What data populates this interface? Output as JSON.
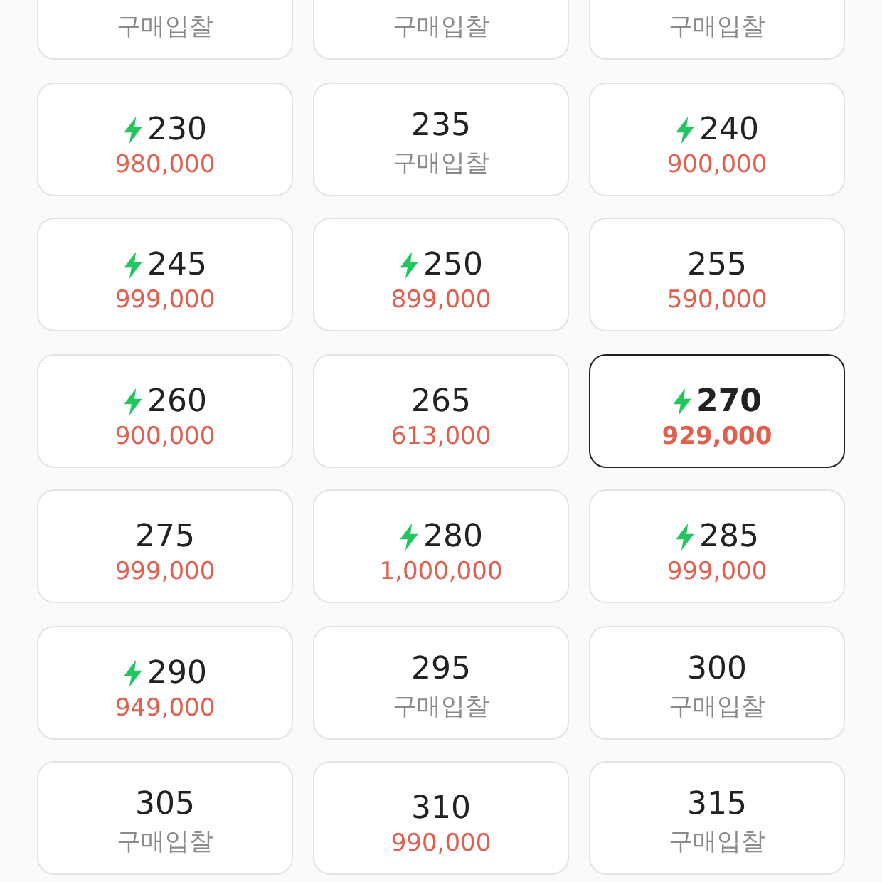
{
  "sizes": [
    {
      "kind": "bid",
      "price": "구매입찰",
      "selected": false
    },
    {
      "kind": "bid",
      "price": "구매입찰",
      "selected": false
    },
    {
      "kind": "bid",
      "price": "구매입찰",
      "selected": false
    },
    {
      "size": "230",
      "kind": "price",
      "price": "980,000",
      "fast": true,
      "selected": false
    },
    {
      "size": "235",
      "kind": "bid",
      "price": "구매입찰",
      "fast": false,
      "selected": false
    },
    {
      "size": "240",
      "kind": "price",
      "price": "900,000",
      "fast": true,
      "selected": false
    },
    {
      "size": "245",
      "kind": "price",
      "price": "999,000",
      "fast": true,
      "selected": false
    },
    {
      "size": "250",
      "kind": "price",
      "price": "899,000",
      "fast": true,
      "selected": false
    },
    {
      "size": "255",
      "kind": "price",
      "price": "590,000",
      "fast": false,
      "selected": false
    },
    {
      "size": "260",
      "kind": "price",
      "price": "900,000",
      "fast": true,
      "selected": false
    },
    {
      "size": "265",
      "kind": "price",
      "price": "613,000",
      "fast": false,
      "selected": false
    },
    {
      "size": "270",
      "kind": "price",
      "price": "929,000",
      "fast": true,
      "selected": true
    },
    {
      "size": "275",
      "kind": "price",
      "price": "999,000",
      "fast": false,
      "selected": false
    },
    {
      "size": "280",
      "kind": "price",
      "price": "1,000,000",
      "fast": true,
      "selected": false
    },
    {
      "size": "285",
      "kind": "price",
      "price": "999,000",
      "fast": true,
      "selected": false
    },
    {
      "size": "290",
      "kind": "price",
      "price": "949,000",
      "fast": true,
      "selected": false
    },
    {
      "size": "295",
      "kind": "bid",
      "price": "구매입찰",
      "fast": false,
      "selected": false
    },
    {
      "size": "300",
      "kind": "bid",
      "price": "구매입찰",
      "fast": false,
      "selected": false
    },
    {
      "size": "305",
      "kind": "bid",
      "price": "구매입찰",
      "fast": false,
      "selected": false
    },
    {
      "size": "310",
      "kind": "price",
      "price": "990,000",
      "fast": false,
      "selected": false
    },
    {
      "size": "315",
      "kind": "bid",
      "price": "구매입찰",
      "fast": false,
      "selected": false
    }
  ]
}
